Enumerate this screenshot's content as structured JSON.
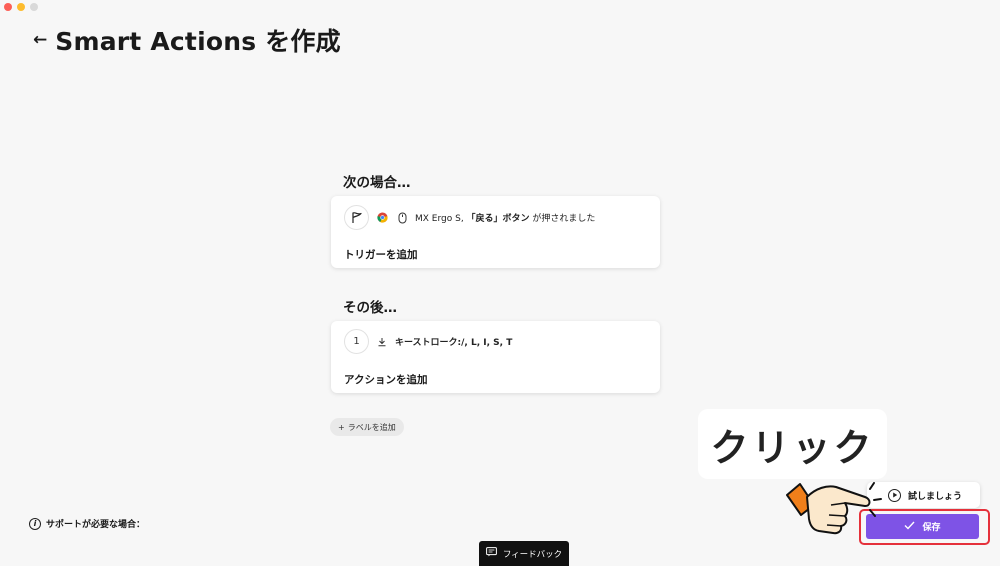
{
  "header": {
    "back_arrow": "←",
    "title": "Smart Actions を作成"
  },
  "trigger_section": {
    "title": "次の場合…",
    "item": {
      "prefix": "MX Ergo S, ",
      "button_name": "「戻る」ボタン",
      "suffix": " が押されました"
    },
    "add_label": "トリガーを追加"
  },
  "action_section": {
    "title": "その後…",
    "item": {
      "number": "1",
      "text": "キーストローク:/, L, I, S, T"
    },
    "add_label": "アクションを追加"
  },
  "add_tag": {
    "plus": "+",
    "label": "ラベルを追加"
  },
  "support": {
    "label": "サポートが必要な場合："
  },
  "feedback": {
    "label": "フィードバック"
  },
  "callout": {
    "text": "クリック"
  },
  "buttons": {
    "try_label": "試しましょう",
    "save_label": "保存"
  },
  "colors": {
    "accent": "#7e53e6",
    "highlight": "#e5313b",
    "hand_cuff": "#f07f1a",
    "hand_skin": "#fbe8cc"
  }
}
